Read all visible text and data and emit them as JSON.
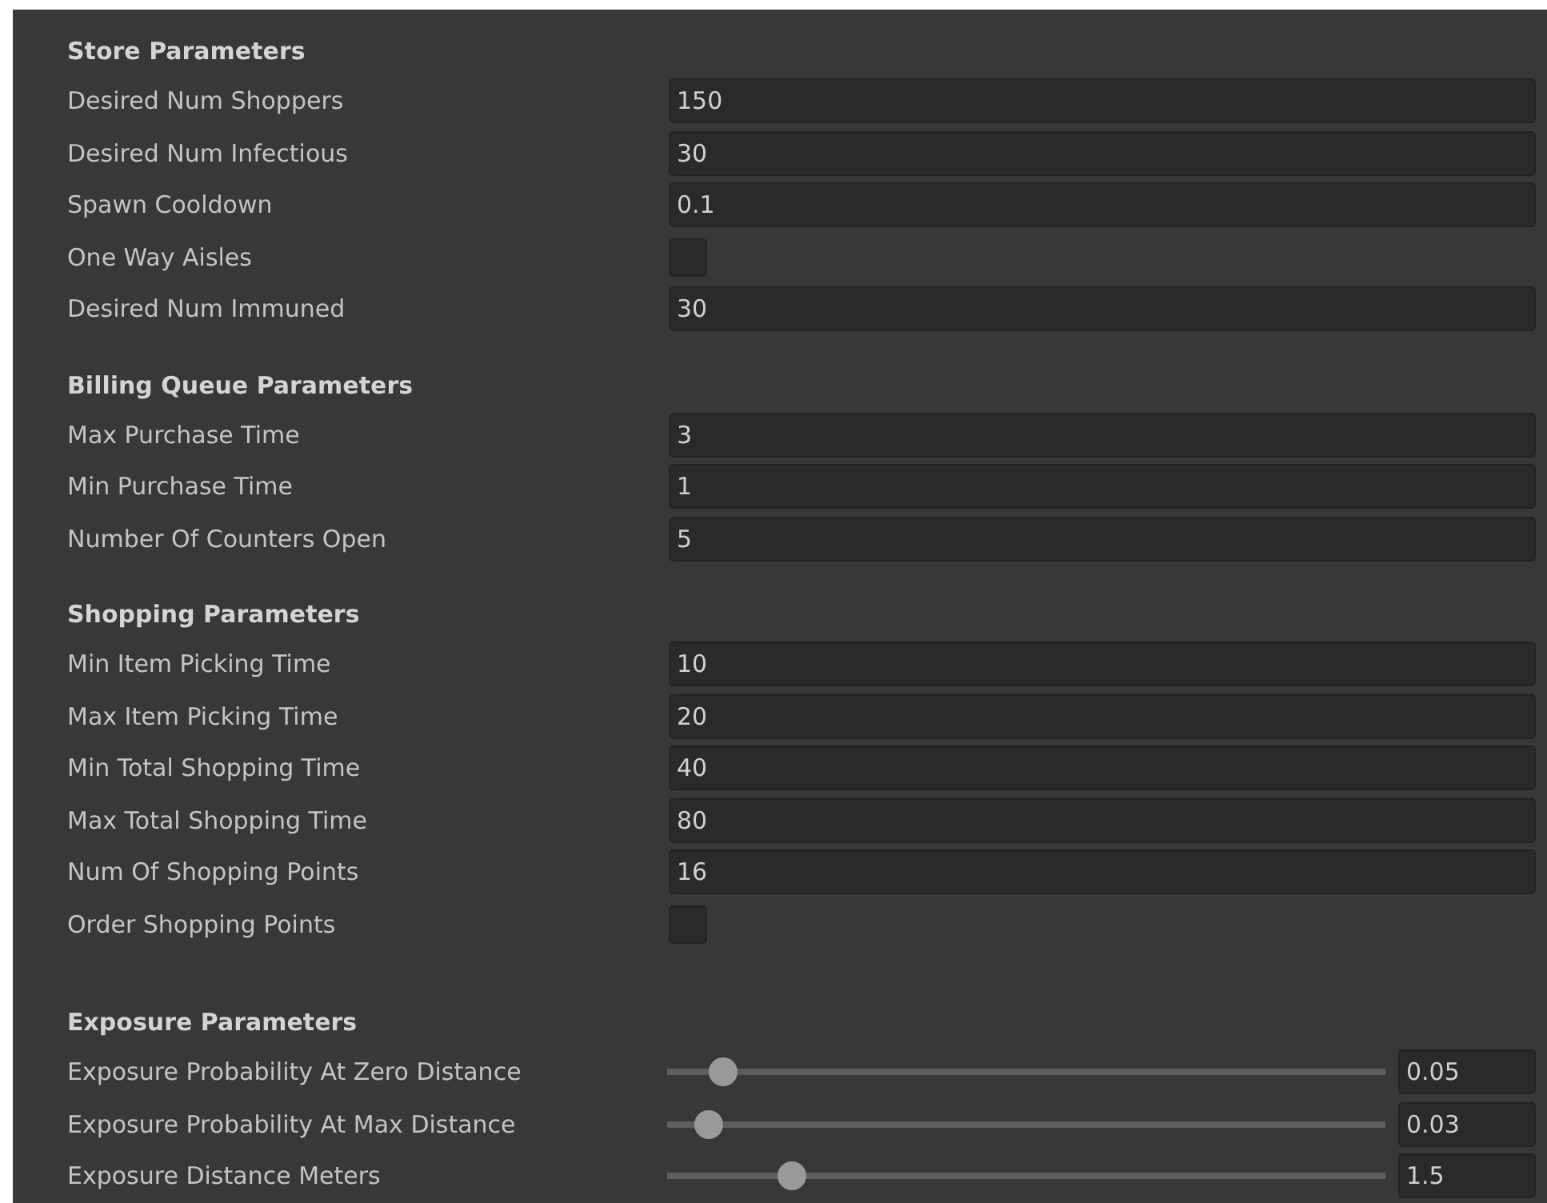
{
  "sections": [
    {
      "title": "Store Parameters",
      "fields": [
        {
          "kind": "number",
          "label": "Desired Num Shoppers",
          "value": "150"
        },
        {
          "kind": "number",
          "label": "Desired Num Infectious",
          "value": "30"
        },
        {
          "kind": "number",
          "label": "Spawn Cooldown",
          "value": "0.1"
        },
        {
          "kind": "toggle",
          "label": "One Way Aisles",
          "checked": false
        },
        {
          "kind": "number",
          "label": "Desired Num Immuned",
          "value": "30"
        }
      ]
    },
    {
      "title": "Billing Queue Parameters",
      "fields": [
        {
          "kind": "number",
          "label": "Max Purchase Time",
          "value": "3"
        },
        {
          "kind": "number",
          "label": "Min Purchase Time",
          "value": "1"
        },
        {
          "kind": "number",
          "label": "Number Of Counters Open",
          "value": "5"
        }
      ]
    },
    {
      "title": "Shopping Parameters",
      "fields": [
        {
          "kind": "number",
          "label": "Min Item Picking Time",
          "value": "10"
        },
        {
          "kind": "number",
          "label": "Max Item Picking Time",
          "value": "20"
        },
        {
          "kind": "number",
          "label": "Min Total Shopping Time",
          "value": "40"
        },
        {
          "kind": "number",
          "label": "Max Total Shopping Time",
          "value": "80"
        },
        {
          "kind": "number",
          "label": "Num Of Shopping Points",
          "value": "16"
        },
        {
          "kind": "toggle",
          "label": "Order Shopping Points",
          "checked": false
        }
      ]
    },
    {
      "title": "Exposure Parameters",
      "fields": [
        {
          "kind": "slider",
          "label": "Exposure Probability At Zero Distance",
          "level": 0.06,
          "value": "0.05"
        },
        {
          "kind": "slider",
          "label": "Exposure Probability At Max Distance",
          "level": 0.04,
          "value": "0.03"
        },
        {
          "kind": "slider",
          "label": "Exposure Distance Meters",
          "level": 0.16,
          "value": "1.5"
        }
      ]
    }
  ]
}
